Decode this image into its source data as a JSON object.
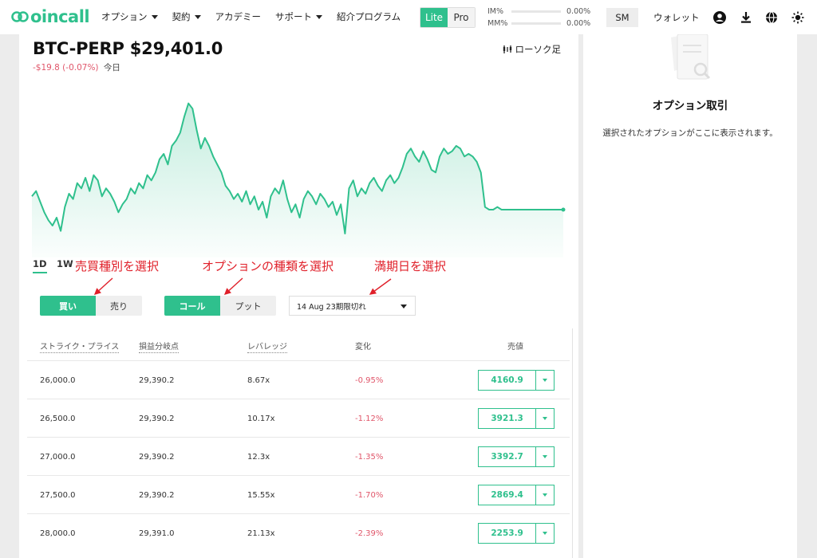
{
  "header": {
    "logo_text": "oincall",
    "nav": [
      {
        "label": "オプション",
        "dropdown": true
      },
      {
        "label": "契約",
        "dropdown": true
      },
      {
        "label": "アカデミー",
        "dropdown": false
      },
      {
        "label": "サポート",
        "dropdown": true
      },
      {
        "label": "紹介プログラム",
        "dropdown": false
      }
    ],
    "mode": {
      "lite": "Lite",
      "pro": "Pro",
      "active": "Lite"
    },
    "margin": [
      {
        "label": "IM%",
        "value": "0.00%"
      },
      {
        "label": "MM%",
        "value": "0.00%"
      }
    ],
    "account_badge": "SM",
    "wallet": "ウォレット",
    "icons": [
      "user-icon",
      "download-icon",
      "globe-icon",
      "theme-sun-icon"
    ]
  },
  "market": {
    "title": "BTC-PERP $29,401.0",
    "change": "-$19.8 (-0.07%)",
    "period": "今日",
    "candle_label": "ローソク足",
    "timeframes": [
      "1D",
      "1W"
    ],
    "active_timeframe": "1D"
  },
  "chart_data": {
    "type": "area",
    "line_color": "#2fc08d",
    "values": [
      55,
      57,
      53,
      49,
      46,
      44,
      47,
      42,
      51,
      56,
      54,
      60,
      58,
      62,
      57,
      63,
      61,
      55,
      58,
      56,
      53,
      49,
      52,
      54,
      58,
      56,
      60,
      58,
      63,
      61,
      64,
      69,
      71,
      67,
      74,
      76,
      79,
      85,
      90,
      88,
      80,
      73,
      77,
      74,
      70,
      67,
      64,
      59,
      57,
      54,
      56,
      53,
      57,
      52,
      55,
      50,
      53,
      47,
      55,
      58,
      56,
      61,
      54,
      49,
      52,
      47,
      54,
      57,
      55,
      52,
      56,
      54,
      51,
      53,
      48,
      52,
      41,
      58,
      61,
      55,
      58,
      56,
      60,
      62,
      59,
      57,
      61,
      63,
      60,
      62,
      66,
      71,
      73,
      70,
      68,
      72,
      69,
      65,
      64,
      70,
      73,
      71,
      72,
      74,
      73,
      70,
      71,
      70,
      68,
      64,
      51,
      50,
      50,
      51,
      50,
      50,
      50,
      50,
      50,
      50,
      50,
      50,
      50,
      50,
      50,
      50,
      50,
      50,
      50,
      50
    ]
  },
  "controls": {
    "side": {
      "buy": "買い",
      "sell": "売り",
      "active": "buy"
    },
    "type": {
      "call": "コール",
      "put": "プット",
      "active": "call"
    },
    "expiry": "14 Aug 23期限切れ"
  },
  "annotations": {
    "side": "売買種別を選択",
    "type": "オプションの種類を選択",
    "expiry": "満期日を選択"
  },
  "table": {
    "headers": [
      "ストライク・プライス",
      "損益分岐点",
      "レバレッジ",
      "変化",
      "売値"
    ],
    "rows": [
      {
        "strike": "26,000.0",
        "breakeven": "29,390.2",
        "leverage": "8.67x",
        "change": "-0.95%",
        "ask": "4160.9"
      },
      {
        "strike": "26,500.0",
        "breakeven": "29,390.2",
        "leverage": "10.17x",
        "change": "-1.12%",
        "ask": "3921.3"
      },
      {
        "strike": "27,000.0",
        "breakeven": "29,390.2",
        "leverage": "12.3x",
        "change": "-1.35%",
        "ask": "3392.7"
      },
      {
        "strike": "27,500.0",
        "breakeven": "29,390.2",
        "leverage": "15.55x",
        "change": "-1.70%",
        "ask": "2869.4"
      },
      {
        "strike": "28,000.0",
        "breakeven": "29,391.0",
        "leverage": "21.13x",
        "change": "-2.39%",
        "ask": "2253.9"
      }
    ]
  },
  "side_panel": {
    "title": "オプション取引",
    "description": "選択されたオプションがここに表示されます。"
  }
}
